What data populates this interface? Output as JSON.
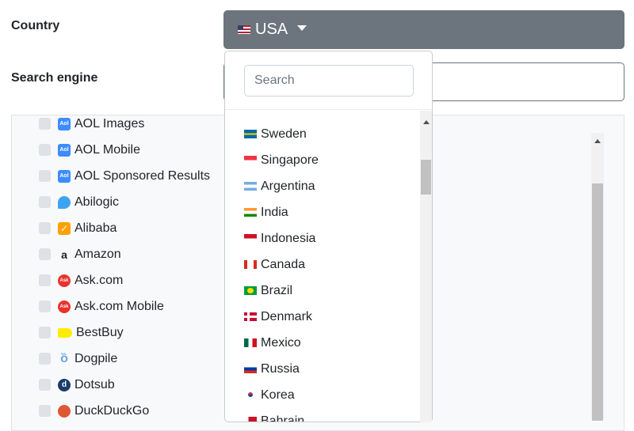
{
  "form": {
    "country_label": "Country",
    "engine_label": "Search engine"
  },
  "country_select": {
    "selected": "USA",
    "selected_flag": "us-flag-icon"
  },
  "dropdown": {
    "search_placeholder": "Search",
    "search_value": "",
    "options": [
      {
        "label": "Sweden",
        "flag": "se"
      },
      {
        "label": "Singapore",
        "flag": "sg"
      },
      {
        "label": "Argentina",
        "flag": "ar"
      },
      {
        "label": "India",
        "flag": "in"
      },
      {
        "label": "Indonesia",
        "flag": "id"
      },
      {
        "label": "Canada",
        "flag": "ca"
      },
      {
        "label": "Brazil",
        "flag": "br"
      },
      {
        "label": "Denmark",
        "flag": "dk"
      },
      {
        "label": "Mexico",
        "flag": "mx"
      },
      {
        "label": "Russia",
        "flag": "ru"
      },
      {
        "label": "Korea",
        "flag": "kr"
      },
      {
        "label": "Bahrain",
        "flag": "bh"
      }
    ]
  },
  "engines": {
    "items": [
      {
        "label": "AOL Images",
        "icon": "aol-icon"
      },
      {
        "label": "AOL Mobile",
        "icon": "aol-icon"
      },
      {
        "label": "AOL Sponsored Results",
        "icon": "aol-icon"
      },
      {
        "label": "Abilogic",
        "icon": "abilogic-icon"
      },
      {
        "label": "Alibaba",
        "icon": "alibaba-icon"
      },
      {
        "label": "Amazon",
        "icon": "amazon-icon"
      },
      {
        "label": "Ask.com",
        "icon": "ask-icon"
      },
      {
        "label": "Ask.com Mobile",
        "icon": "ask-icon"
      },
      {
        "label": "BestBuy",
        "icon": "bestbuy-icon"
      },
      {
        "label": "Dogpile",
        "icon": "dogpile-icon"
      },
      {
        "label": "Dotsub",
        "icon": "dotsub-icon"
      },
      {
        "label": "DuckDuckGo",
        "icon": "duckduckgo-icon"
      }
    ]
  },
  "colors": {
    "country_button_bg": "#6c757d",
    "panel_bg": "#f8f9fa"
  }
}
